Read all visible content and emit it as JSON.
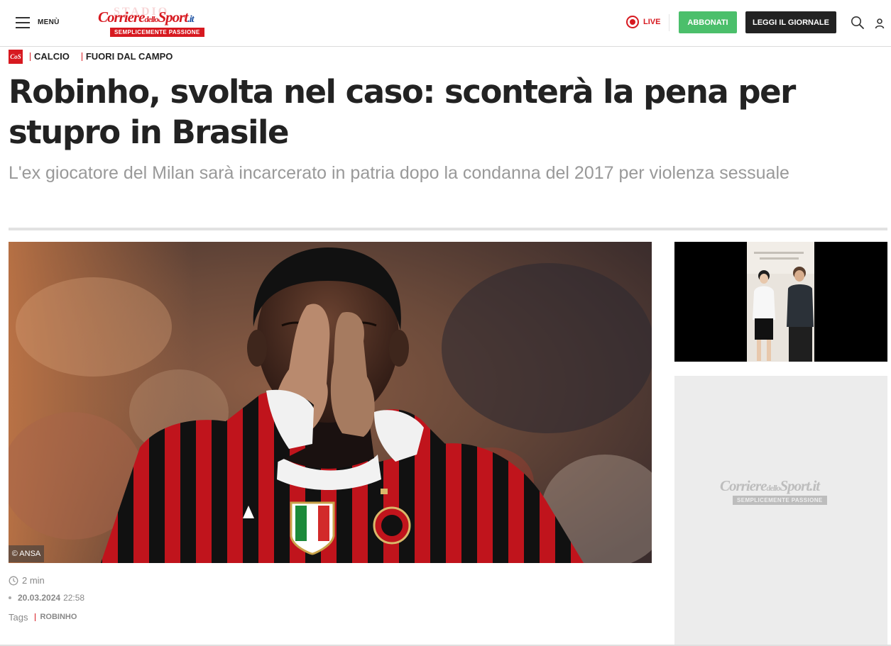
{
  "header": {
    "menu_label": "MENÙ",
    "logo_main": "Corriere",
    "logo_dello": "dello",
    "logo_sport": "Sport",
    "logo_tld": ".it",
    "logo_ghost": "STADIO",
    "logo_tagline": "SEMPLICEMENTE PASSIONE",
    "live_label": "LIVE",
    "subscribe_label": "ABBONATI",
    "newspaper_label": "LEGGI IL GIORNALE",
    "brand_color": "#d71920",
    "subscribe_color": "#4bbf6b"
  },
  "breadcrumb": {
    "badge": "CoS",
    "items": [
      "CALCIO",
      "FUORI DAL CAMPO"
    ]
  },
  "article": {
    "headline": "Robinho, svolta nel caso: sconterà la pena per stupro in Brasile",
    "subheadline": "L'ex giocatore del Milan sarà incarcerato in patria dopo la condanna del 2017 per violenza sessuale",
    "image_credit": "© ANSA",
    "read_time": "2 min",
    "date": "20.03.2024",
    "time": "22:58",
    "tags_label": "Tags",
    "tags": [
      "ROBINHO"
    ]
  },
  "sidebar": {
    "ad_logo_main": "Corriere",
    "ad_logo_dello": "dello",
    "ad_logo_sport": "Sport",
    "ad_logo_tld": ".it",
    "ad_logo_tagline": "SEMPLICEMENTE PASSIONE"
  }
}
